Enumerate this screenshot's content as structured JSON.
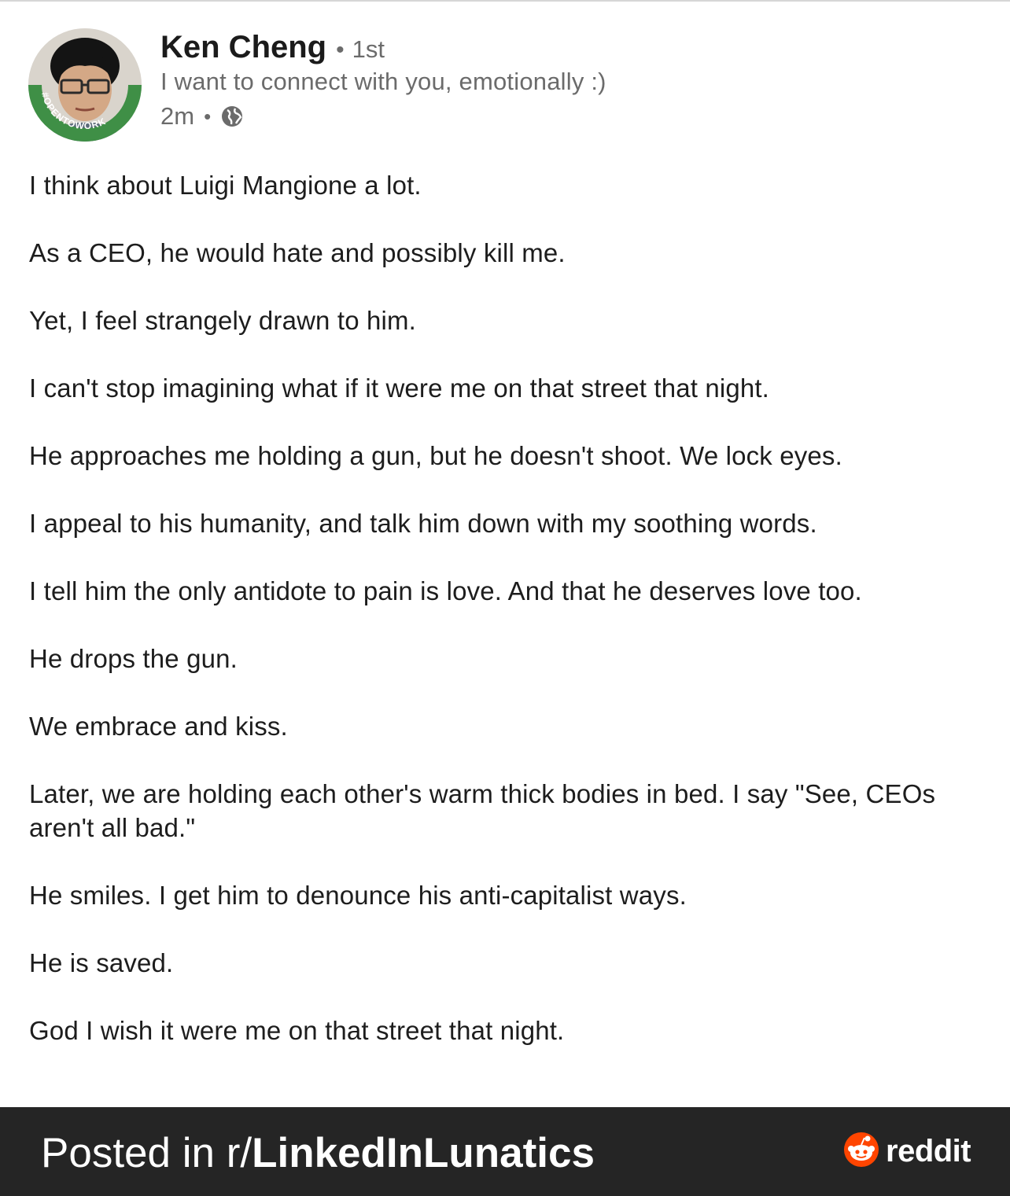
{
  "post": {
    "author": {
      "name": "Ken Cheng",
      "connection_degree": "1st",
      "headline": "I want to connect with you, emotionally :)",
      "avatar_badge": "#OPENTOWORK",
      "badge_color": "#3f8f46"
    },
    "meta": {
      "time": "2m",
      "visibility_icon": "globe-icon"
    },
    "paragraphs": [
      "I think about Luigi Mangione a lot.",
      "As a CEO, he would hate and possibly kill me.",
      "Yet, I feel strangely drawn to him.",
      "I can't stop imagining what if it were me on that street that night.",
      "He approaches me holding a gun, but he doesn't shoot. We lock eyes.",
      "I appeal to his humanity, and talk him down with my soothing words.",
      "I tell him the only antidote to pain is love. And that he deserves love too.",
      "He drops the gun.",
      "We embrace and kiss.",
      "Later, we are holding each other's warm thick bodies in bed. I say \"See, CEOs aren't all bad.\"",
      "He smiles. I get him to denounce his anti-capitalist ways.",
      "He is saved.",
      "God I wish it were me on that street that night."
    ]
  },
  "footer": {
    "posted_in_prefix": "Posted in r/",
    "subreddit": "LinkedInLunatics",
    "brand": "reddit",
    "brand_icon": "reddit-snoo-icon",
    "brand_color": "#ff4500",
    "background": "#252525"
  }
}
